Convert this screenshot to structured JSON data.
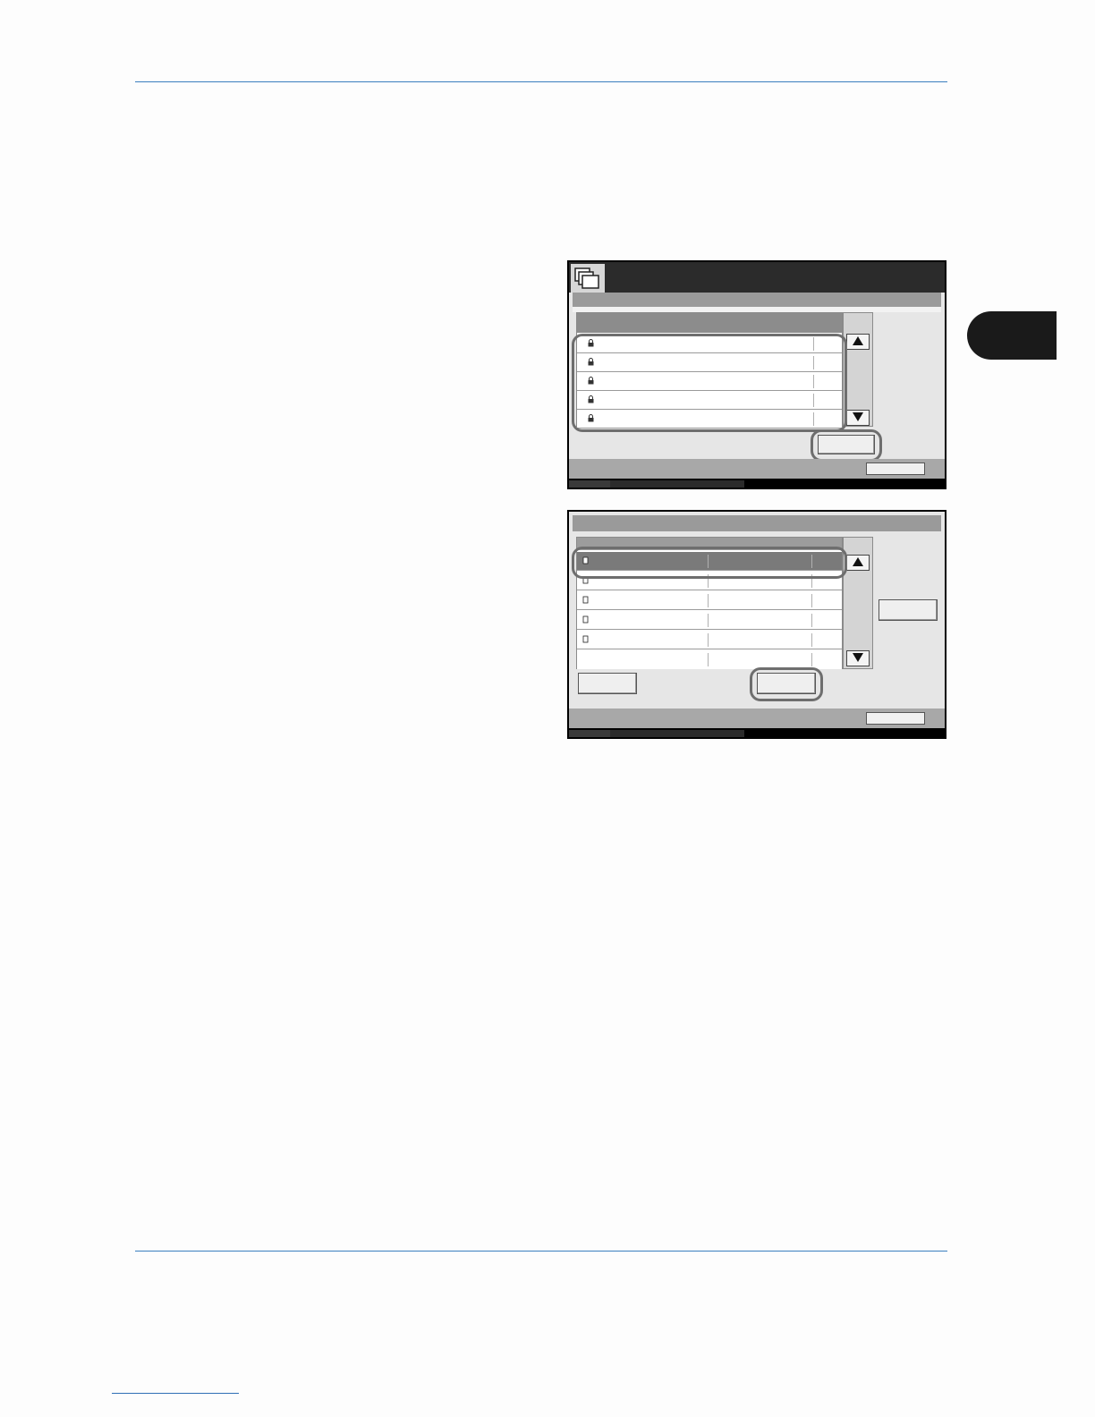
{
  "page": {
    "accent_color": "#3b7fbf",
    "chapter_tab_color": "#1a1a1a"
  },
  "screen1": {
    "icon": "document-box-icon",
    "rows": [
      {
        "icon": "user-lock-icon"
      },
      {
        "icon": "user-lock-icon"
      },
      {
        "icon": "user-lock-icon"
      },
      {
        "icon": "user-lock-icon"
      },
      {
        "icon": "user-lock-icon"
      }
    ],
    "scroll_up_icon": "triangle-up-icon",
    "scroll_down_icon": "triangle-down-icon"
  },
  "screen2": {
    "rows": [
      {
        "icon": "document-icon",
        "selected": true
      },
      {
        "icon": "document-icon",
        "selected": false
      },
      {
        "icon": "document-icon",
        "selected": false
      },
      {
        "icon": "document-icon",
        "selected": false
      },
      {
        "icon": "document-icon",
        "selected": false
      },
      {
        "icon": "",
        "selected": false
      }
    ],
    "scroll_up_icon": "triangle-up-icon",
    "scroll_down_icon": "triangle-down-icon"
  }
}
